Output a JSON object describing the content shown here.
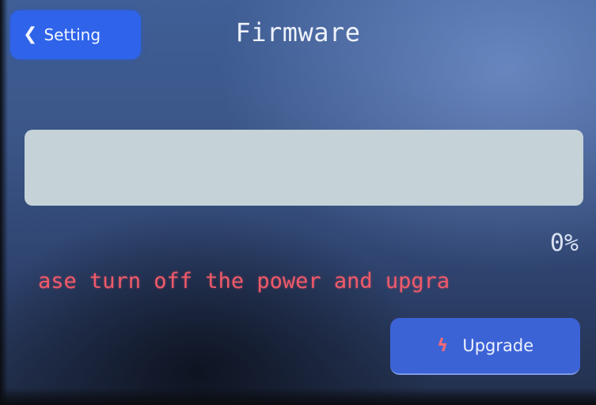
{
  "header": {
    "back_label": "Setting",
    "title": "Firmware"
  },
  "progress": {
    "value": 0,
    "percent_label": "0%"
  },
  "warning": {
    "text": "ase turn off the power and upgra",
    "color": "#f05a6a"
  },
  "actions": {
    "upgrade_label": "Upgrade",
    "upgrade_icon": "lightning-bolt-icon"
  },
  "colors": {
    "accent": "#2e63ea",
    "track": "#c5d3d8"
  }
}
